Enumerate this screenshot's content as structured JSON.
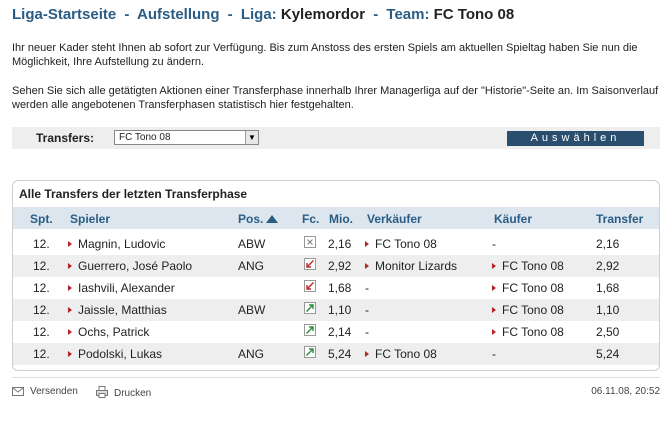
{
  "breadcrumb": {
    "start": "Liga-Startseite",
    "sep1": "-",
    "lineup": "Aufstellung",
    "sep2": "-",
    "league_label": "Liga:",
    "league_name": "Kylemordor",
    "sep3": "-",
    "team_label": "Team:",
    "team_name": "FC Tono 08"
  },
  "intro": {
    "p1": "Ihr neuer Kader steht Ihnen ab sofort zur Verfügung. Bis zum Anstoss des ersten Spiels am aktuellen Spieltag haben Sie nun die Möglichkeit, Ihre Aufstellung zu ändern.",
    "p2": "Sehen Sie sich alle getätigten Aktionen einer Transferphase innerhalb Ihrer Managerliga auf der \"Historie\"-Seite an. Im Saisonverlauf werden alle angebotenen Transferphasen statistisch hier festgehalten."
  },
  "filter": {
    "label": "Transfers:",
    "selected": "FC Tono 08",
    "button": "Auswählen"
  },
  "table": {
    "title": "Alle Transfers der letzten Transferphase",
    "headers": {
      "spt": "Spt.",
      "spieler": "Spieler",
      "pos": "Pos.",
      "fc": "Fc.",
      "mio": "Mio.",
      "verkaeufer": "Verkäufer",
      "kaeufer": "Käufer",
      "transfer": "Transfer"
    },
    "rows": [
      {
        "spt": "12.",
        "spieler": "Magnin, Ludovic",
        "pos": "ABW",
        "trend": "neutral",
        "mio": "2,16",
        "verkaeufer": "FC Tono 08",
        "kaeufer": "-",
        "transfer": "2,16"
      },
      {
        "spt": "12.",
        "spieler": "Guerrero, José Paolo",
        "pos": "ANG",
        "trend": "down",
        "mio": "2,92",
        "verkaeufer": "Monitor Lizards",
        "kaeufer": "FC Tono 08",
        "transfer": "2,92"
      },
      {
        "spt": "12.",
        "spieler": "Iashvili, Alexander",
        "pos": "",
        "trend": "down",
        "mio": "1,68",
        "verkaeufer": "-",
        "kaeufer": "FC Tono 08",
        "transfer": "1,68"
      },
      {
        "spt": "12.",
        "spieler": "Jaissle, Matthias",
        "pos": "ABW",
        "trend": "up",
        "mio": "1,10",
        "verkaeufer": "-",
        "kaeufer": "FC Tono 08",
        "transfer": "1,10"
      },
      {
        "spt": "12.",
        "spieler": "Ochs, Patrick",
        "pos": "",
        "trend": "up",
        "mio": "2,14",
        "verkaeufer": "-",
        "kaeufer": "FC Tono 08",
        "transfer": "2,50"
      },
      {
        "spt": "12.",
        "spieler": "Podolski, Lukas",
        "pos": "ANG",
        "trend": "up",
        "mio": "5,24",
        "verkaeufer": "FC Tono 08",
        "kaeufer": "-",
        "transfer": "5,24"
      }
    ]
  },
  "footer": {
    "send": "Versenden",
    "print": "Drucken",
    "date": "06.11.08, 20:52"
  },
  "colors": {
    "link": "#2a5d86",
    "bullet": "#b3242a",
    "header_bg": "#dde6ee",
    "button_bg": "#2a4f6e",
    "trend_up": "#2e8b3a",
    "trend_down": "#c0262c"
  }
}
